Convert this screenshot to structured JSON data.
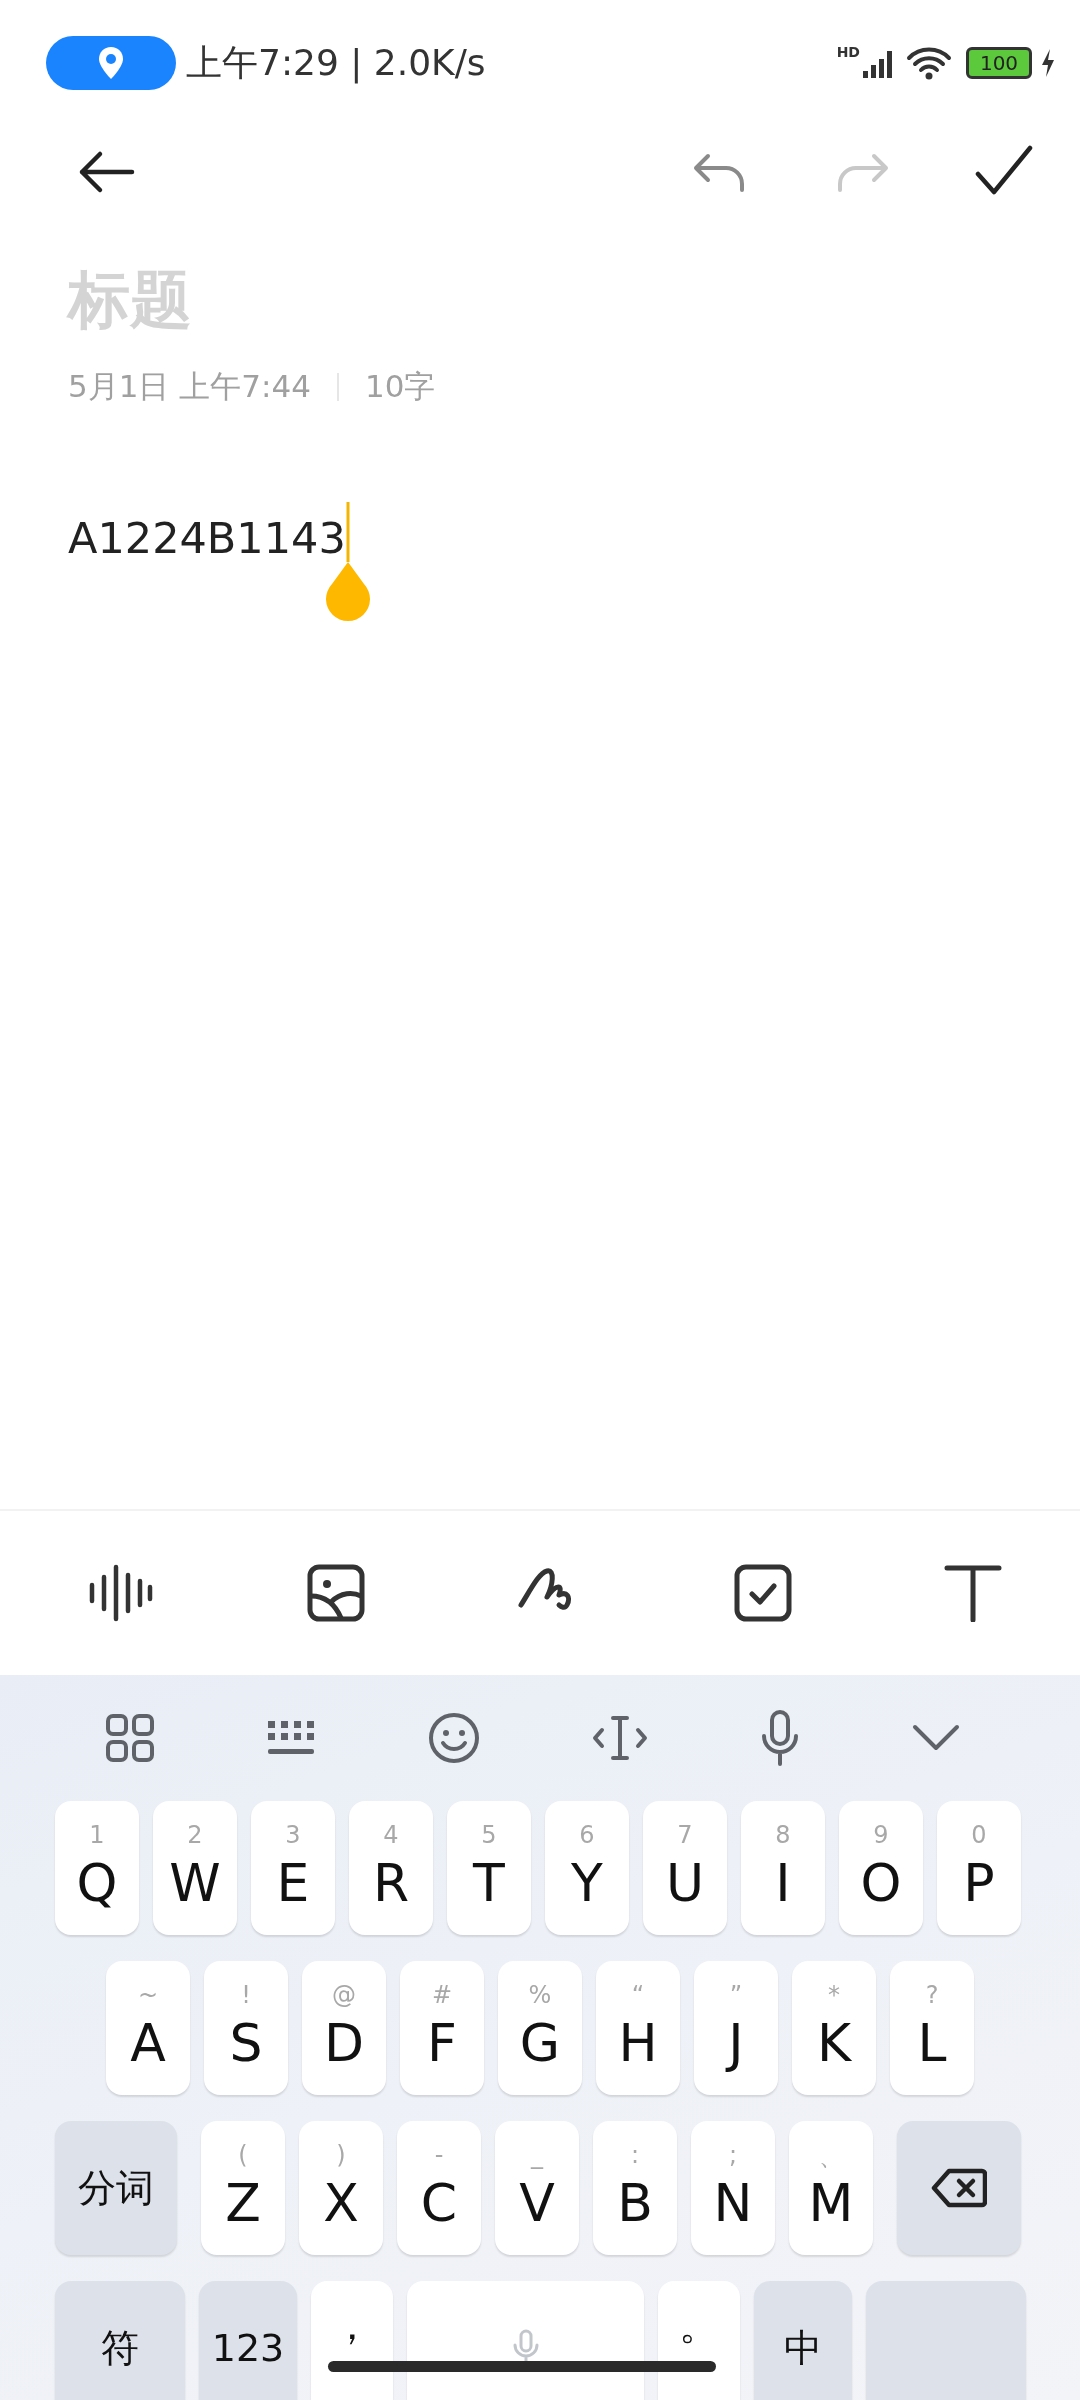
{
  "status_bar": {
    "time_speed": "上午7:29 | 2.0K/s",
    "signal_label": "HD",
    "battery": "100",
    "charging": true
  },
  "top_bar": {
    "undo": {
      "disabled": false
    },
    "redo": {
      "disabled": true
    }
  },
  "note": {
    "title": {
      "placeholder": "标题"
    },
    "date": "5月1日 上午7:44",
    "count": "10字",
    "body": "A1224B1143"
  },
  "keyboard": {
    "rows": [
      [
        {
          "kind": "letter",
          "label": "Q",
          "hint": "1"
        },
        {
          "kind": "letter",
          "label": "W",
          "hint": "2"
        },
        {
          "kind": "letter",
          "label": "E",
          "hint": "3"
        },
        {
          "kind": "letter",
          "label": "R",
          "hint": "4"
        },
        {
          "kind": "letter",
          "label": "T",
          "hint": "5"
        },
        {
          "kind": "letter",
          "label": "Y",
          "hint": "6"
        },
        {
          "kind": "letter",
          "label": "U",
          "hint": "7"
        },
        {
          "kind": "letter",
          "label": "I",
          "hint": "8"
        },
        {
          "kind": "letter",
          "label": "O",
          "hint": "9"
        },
        {
          "kind": "letter",
          "label": "P",
          "hint": "0"
        }
      ],
      [
        {
          "kind": "letter",
          "label": "A",
          "hint": "~"
        },
        {
          "kind": "letter",
          "label": "S",
          "hint": "!"
        },
        {
          "kind": "letter",
          "label": "D",
          "hint": "@"
        },
        {
          "kind": "letter",
          "label": "F",
          "hint": "#"
        },
        {
          "kind": "letter",
          "label": "G",
          "hint": "%"
        },
        {
          "kind": "letter",
          "label": "H",
          "hint": "“"
        },
        {
          "kind": "letter",
          "label": "J",
          "hint": "”"
        },
        {
          "kind": "letter",
          "label": "K",
          "hint": "*"
        },
        {
          "kind": "letter",
          "label": "L",
          "hint": "?"
        }
      ],
      [
        {
          "kind": "function",
          "label": "分词"
        },
        {
          "kind": "letter",
          "label": "Z",
          "hint": "("
        },
        {
          "kind": "letter",
          "label": "X",
          "hint": ")"
        },
        {
          "kind": "letter",
          "label": "C",
          "hint": "-"
        },
        {
          "kind": "letter",
          "label": "V",
          "hint": "_"
        },
        {
          "kind": "letter",
          "label": "B",
          "hint": ":"
        },
        {
          "kind": "letter",
          "label": "N",
          "hint": ";"
        },
        {
          "kind": "letter",
          "label": "M",
          "hint": "、"
        },
        {
          "kind": "backspace"
        }
      ],
      [
        {
          "kind": "function",
          "label": "符"
        },
        {
          "kind": "function",
          "label": "123"
        },
        {
          "kind": "punct",
          "label": "，"
        },
        {
          "kind": "space"
        },
        {
          "kind": "punct",
          "label": "。"
        },
        {
          "kind": "function",
          "label": "中"
        },
        {
          "kind": "blank"
        }
      ]
    ]
  }
}
